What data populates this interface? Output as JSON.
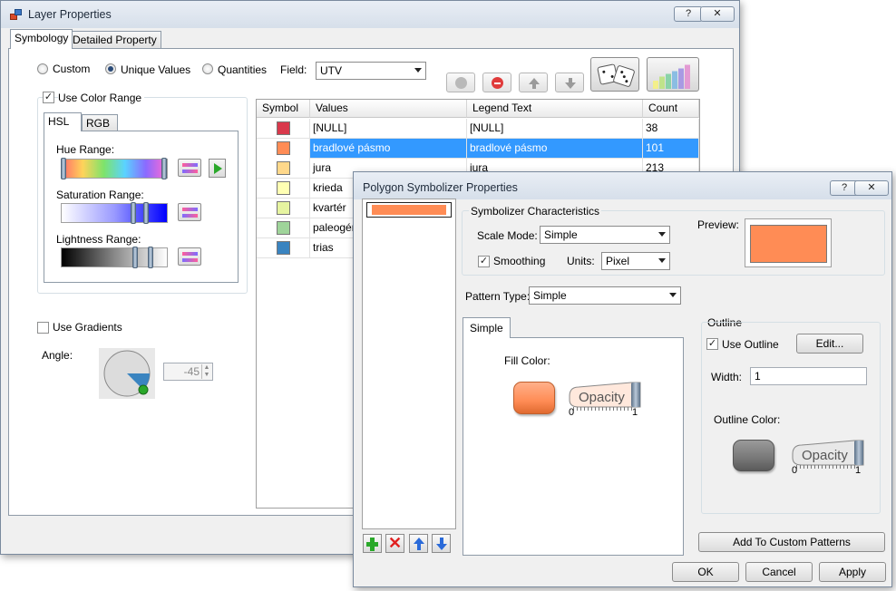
{
  "layer_window": {
    "title": "Layer Properties",
    "help_label": "?",
    "close_label": "✕",
    "tabs": [
      "Symbology",
      "Detailed Property"
    ],
    "modes": {
      "custom": "Custom",
      "unique": "Unique Values",
      "quantities": "Quantities"
    },
    "field_label": "Field:",
    "field_value": "UTV",
    "use_color_range": "Use Color Range",
    "color_tabs": [
      "HSL",
      "RGB"
    ],
    "hue_range": "Hue Range:",
    "saturation_range": "Saturation Range:",
    "lightness_range": "Lightness Range:",
    "use_gradients": "Use Gradients",
    "angle_label": "Angle:",
    "angle_value": "-45",
    "table": {
      "headers": [
        "Symbol",
        "Values",
        "Legend Text",
        "Count"
      ],
      "rows": [
        {
          "value": "[NULL]",
          "legend": "[NULL]",
          "count": "38",
          "color": "#d9394c"
        },
        {
          "value": "bradlové pásmo",
          "legend": "bradlové pásmo",
          "count": "101",
          "color": "#ff8c55"
        },
        {
          "value": "jura",
          "legend": "jura",
          "count": "213",
          "color": "#ffd88a"
        },
        {
          "value": "krieda",
          "legend": "",
          "count": "",
          "color": "#ffffb3"
        },
        {
          "value": "kvartér",
          "legend": "",
          "count": "",
          "color": "#e6f4a0"
        },
        {
          "value": "paleogén",
          "legend": "",
          "count": "",
          "color": "#9fd49a"
        },
        {
          "value": "trias",
          "legend": "",
          "count": "",
          "color": "#3a84c0"
        }
      ]
    }
  },
  "polygon_window": {
    "title": "Polygon Symbolizer Properties",
    "help_label": "?",
    "close_label": "✕",
    "symbolizer_characteristics": "Symbolizer Characteristics",
    "scale_mode_label": "Scale Mode:",
    "scale_mode_value": "Simple",
    "smoothing": "Smoothing",
    "units_label": "Units:",
    "units_value": "Pixel",
    "preview_label": "Preview:",
    "pattern_type_label": "Pattern Type:",
    "pattern_type_value": "Simple",
    "simple_tab": "Simple",
    "fill_color_label": "Fill Color:",
    "opacity_label": "Opacity",
    "opacity_min": "0",
    "opacity_max": "1",
    "outline_label": "Outline",
    "use_outline": "Use Outline",
    "edit_button": "Edit...",
    "width_label": "Width:",
    "width_value": "1",
    "outline_color_label": "Outline Color:",
    "add_custom_patterns": "Add To Custom Patterns",
    "ok": "OK",
    "cancel": "Cancel",
    "apply": "Apply",
    "fill_color": "#ff8c55",
    "outline_color": "#777777"
  }
}
